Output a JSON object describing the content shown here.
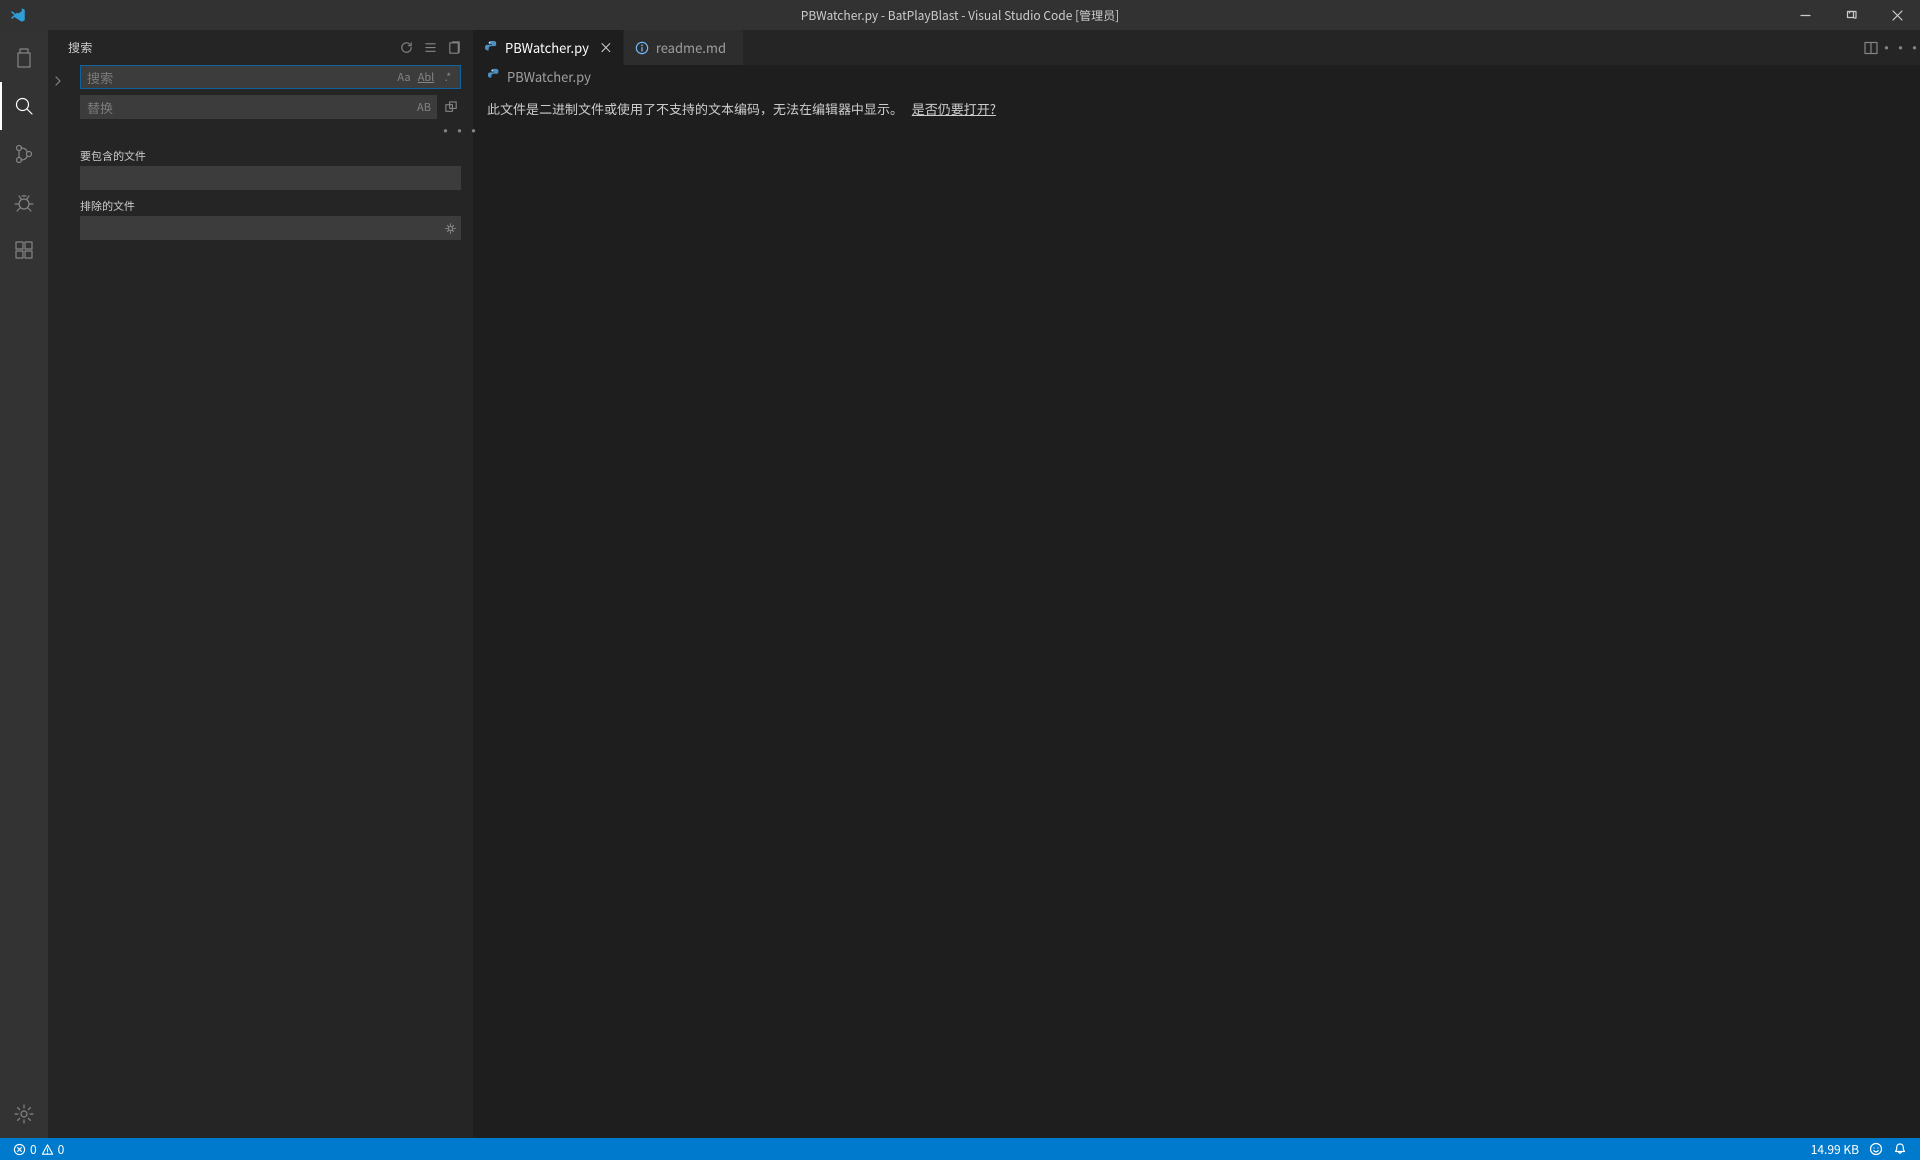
{
  "titlebar": {
    "title": "PBWatcher.py - BatPlayBlast - Visual Studio Code [管理员]"
  },
  "activity": {
    "items": [
      "explorer",
      "search",
      "scm",
      "debug",
      "extensions"
    ],
    "active": "search"
  },
  "sidebar": {
    "title": "搜索",
    "search_placeholder": "搜索",
    "replace_placeholder": "替换",
    "include_label": "要包含的文件",
    "exclude_label": "排除的文件",
    "opts": {
      "case": "Aa",
      "word": "Abl",
      "regex": ".*",
      "preserve": "AB"
    }
  },
  "tabs": [
    {
      "icon": "python",
      "label": "PBWatcher.py",
      "active": true,
      "closeable": true
    },
    {
      "icon": "info",
      "label": "readme.md",
      "active": false,
      "closeable": false
    }
  ],
  "breadcrumb": {
    "icon": "python",
    "label": "PBWatcher.py"
  },
  "editor": {
    "message": "此文件是二进制文件或使用了不支持的文本编码，无法在编辑器中显示。",
    "link": "是否仍要打开?"
  },
  "status": {
    "errors": "0",
    "warnings": "0",
    "filesize": "14.99 KB"
  }
}
